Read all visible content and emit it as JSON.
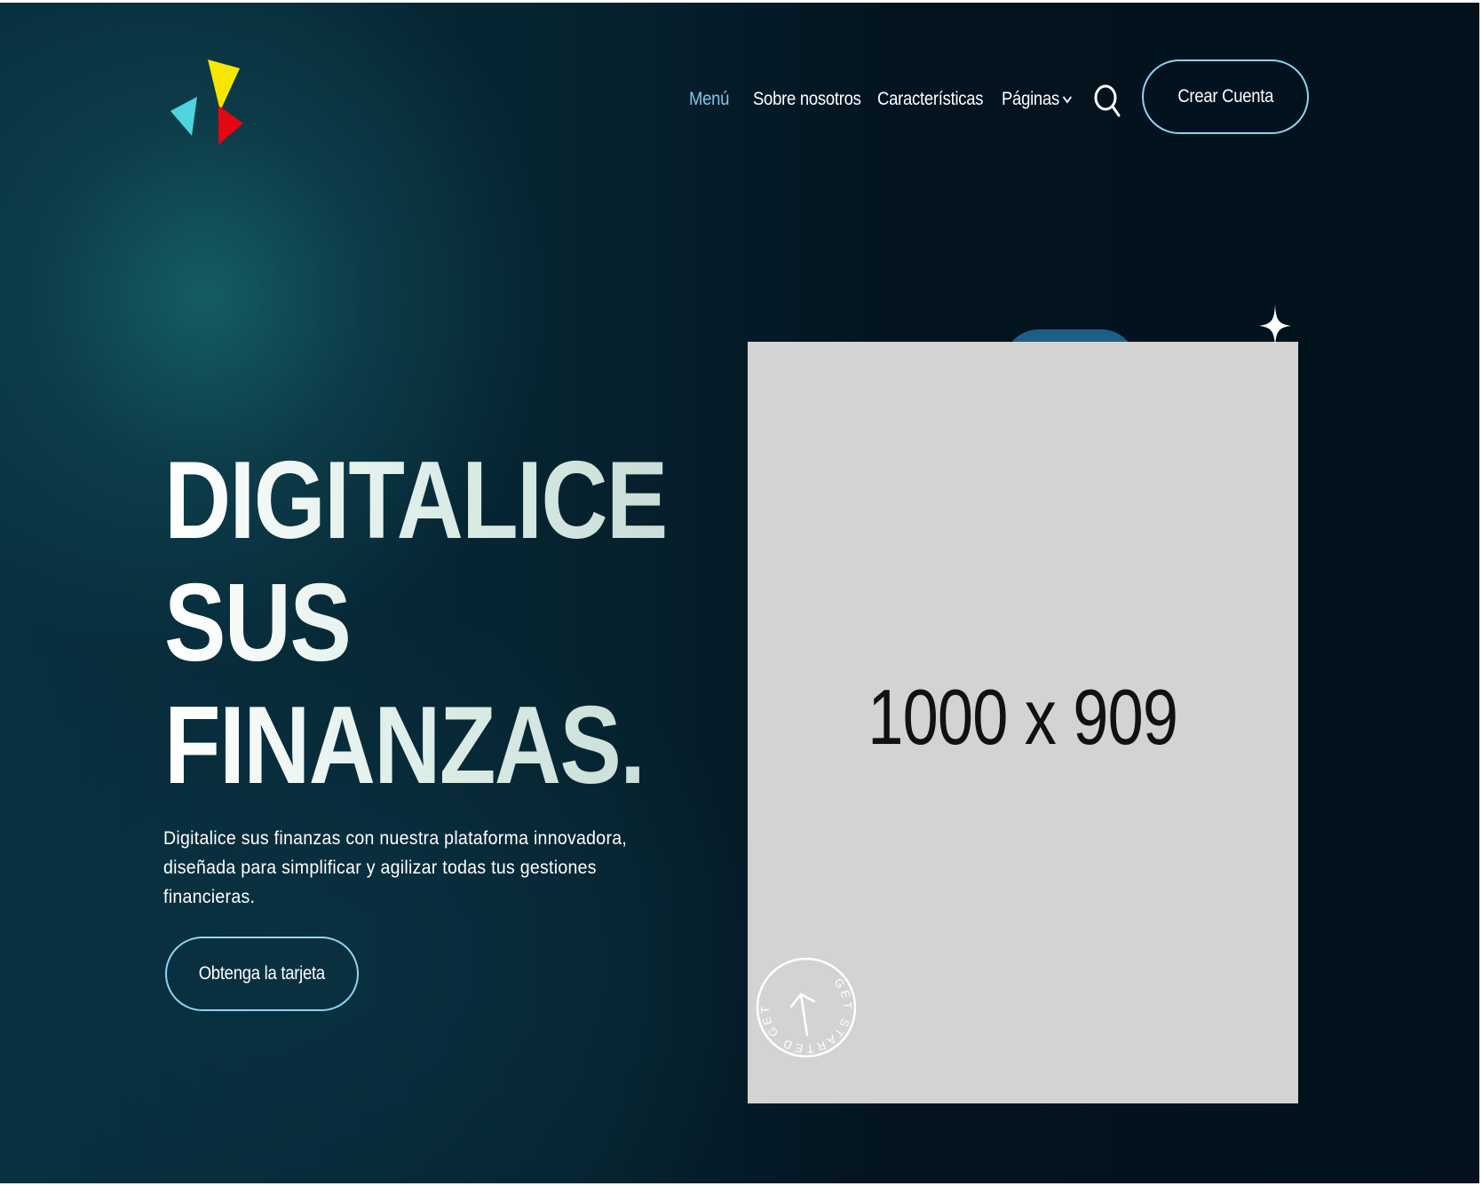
{
  "nav": {
    "items": [
      {
        "label": "Menú",
        "active": true
      },
      {
        "label": "Sobre nosotros",
        "active": false
      },
      {
        "label": "Características",
        "active": false
      },
      {
        "label": "Páginas",
        "active": false,
        "dropdown": true
      }
    ],
    "search_icon": "search-icon",
    "cta_label": "Crear Cuenta"
  },
  "logo": {
    "colors": [
      "#f5e700",
      "#4fd3e0",
      "#e30613"
    ]
  },
  "hero": {
    "title_lines": [
      "DIGITALICE",
      "SUS",
      "FINANZAS."
    ],
    "description": "Digitalice sus finanzas con nuestra plataforma innovadora, diseñada para simplificar y agilizar todas tus gestiones financieras.",
    "cta_label": "Obtenga la tarjeta"
  },
  "image": {
    "placeholder_text": "1000 x 909"
  },
  "badge": {
    "text": "GET STARTED GET STARTED "
  },
  "colors": {
    "accent": "#8fd3f2",
    "active_nav": "#7fc6ea",
    "background": "#031420"
  }
}
